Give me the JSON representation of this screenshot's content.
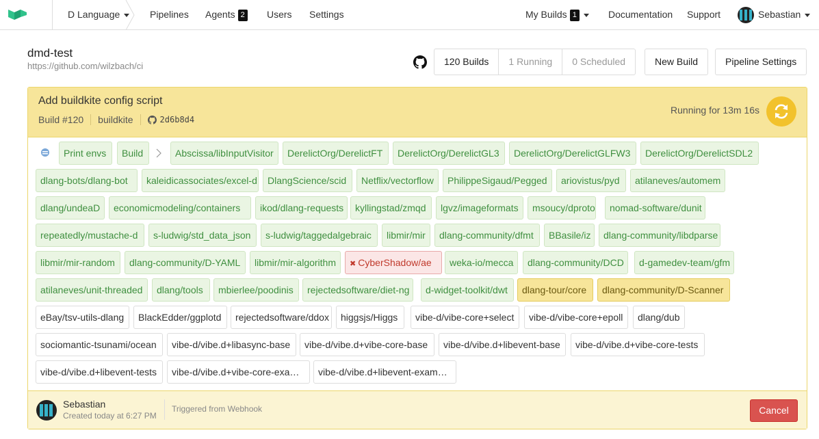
{
  "nav": {
    "org": "D Language",
    "links": [
      "Pipelines",
      "Agents",
      "Users",
      "Settings"
    ],
    "agents_count": "2",
    "my_builds": "My Builds",
    "my_builds_count": "1",
    "documentation": "Documentation",
    "support": "Support",
    "user": "Sebastian"
  },
  "pipeline": {
    "name": "dmd-test",
    "url": "https://github.com/wilzbach/ci",
    "builds": "120 Builds",
    "running": "1 Running",
    "scheduled": "0 Scheduled",
    "new_build": "New Build",
    "settings": "Pipeline Settings"
  },
  "build": {
    "message": "Add buildkite config script",
    "number": "Build #120",
    "branch": "buildkite",
    "commit": "2d6b8d4",
    "running_for": "Running for 13m 16s",
    "colors": {
      "head": "#f7e59a",
      "spinner": "#f2c22c",
      "passed": "#3f8f3f",
      "failed": "#c0392b"
    }
  },
  "jobs": [
    {
      "label": "",
      "state": "icon"
    },
    {
      "label": "Print envs",
      "state": "passed"
    },
    {
      "label": "Build",
      "state": "passed"
    },
    {
      "label": "Abscissa/libInputVisitor",
      "state": "passed"
    },
    {
      "label": "DerelictOrg/DerelictFT",
      "state": "passed"
    },
    {
      "label": "DerelictOrg/DerelictGL3",
      "state": "passed"
    },
    {
      "label": "DerelictOrg/DerelictGLFW3",
      "state": "passed"
    },
    {
      "label": "DerelictOrg/DerelictSDL2",
      "state": "passed"
    },
    {
      "label": "dlang-bots/dlang-bot",
      "state": "passed"
    },
    {
      "label": "kaleidicassociates/excel-d",
      "state": "passed"
    },
    {
      "label": "DlangScience/scid",
      "state": "passed"
    },
    {
      "label": "Netflix/vectorflow",
      "state": "passed"
    },
    {
      "label": "PhilippeSigaud/Pegged",
      "state": "passed"
    },
    {
      "label": "ariovistus/pyd",
      "state": "passed"
    },
    {
      "label": "atilaneves/automem",
      "state": "passed"
    },
    {
      "label": "dlang/undeaD",
      "state": "passed"
    },
    {
      "label": "economicmodeling/containers",
      "state": "passed"
    },
    {
      "label": "ikod/dlang-requests",
      "state": "passed"
    },
    {
      "label": "kyllingstad/zmqd",
      "state": "passed"
    },
    {
      "label": "lgvz/imageformats",
      "state": "passed"
    },
    {
      "label": "msoucy/dproto",
      "state": "passed"
    },
    {
      "label": "nomad-software/dunit",
      "state": "passed"
    },
    {
      "label": "repeatedly/mustache-d",
      "state": "passed"
    },
    {
      "label": "s-ludwig/std_data_json",
      "state": "passed"
    },
    {
      "label": "s-ludwig/taggedalgebraic",
      "state": "passed"
    },
    {
      "label": "libmir/mir",
      "state": "passed"
    },
    {
      "label": "dlang-community/dfmt",
      "state": "passed"
    },
    {
      "label": "BBasile/iz",
      "state": "passed"
    },
    {
      "label": "dlang-community/libdparse",
      "state": "passed"
    },
    {
      "label": "libmir/mir-random",
      "state": "passed"
    },
    {
      "label": "dlang-community/D-YAML",
      "state": "passed"
    },
    {
      "label": "libmir/mir-algorithm",
      "state": "passed"
    },
    {
      "label": "CyberShadow/ae",
      "state": "failed"
    },
    {
      "label": "weka-io/mecca",
      "state": "passed"
    },
    {
      "label": "dlang-community/DCD",
      "state": "passed"
    },
    {
      "label": "d-gamedev-team/gfm",
      "state": "passed"
    },
    {
      "label": "atilaneves/unit-threaded",
      "state": "passed"
    },
    {
      "label": "dlang/tools",
      "state": "passed"
    },
    {
      "label": "mbierlee/poodinis",
      "state": "passed"
    },
    {
      "label": "rejectedsoftware/diet-ng",
      "state": "passed"
    },
    {
      "label": "d-widget-toolkit/dwt",
      "state": "passed"
    },
    {
      "label": "dlang-tour/core",
      "state": "running"
    },
    {
      "label": "dlang-community/D-Scanner",
      "state": "running"
    },
    {
      "label": "eBay/tsv-utils-dlang",
      "state": "pending"
    },
    {
      "label": "BlackEdder/ggplotd",
      "state": "pending"
    },
    {
      "label": "rejectedsoftware/ddox",
      "state": "pending"
    },
    {
      "label": "higgsjs/Higgs",
      "state": "pending"
    },
    {
      "label": "vibe-d/vibe-core+select",
      "state": "pending"
    },
    {
      "label": "vibe-d/vibe-core+epoll",
      "state": "pending"
    },
    {
      "label": "dlang/dub",
      "state": "pending"
    },
    {
      "label": "sociomantic-tsunami/ocean",
      "state": "pending"
    },
    {
      "label": "vibe-d/vibe.d+libasync-base",
      "state": "pending"
    },
    {
      "label": "vibe-d/vibe.d+vibe-core-base",
      "state": "pending"
    },
    {
      "label": "vibe-d/vibe.d+libevent-base",
      "state": "pending"
    },
    {
      "label": "vibe-d/vibe.d+vibe-core-tests",
      "state": "pending"
    },
    {
      "label": "vibe-d/vibe.d+libevent-tests",
      "state": "pending"
    },
    {
      "label": "vibe-d/vibe.d+vibe-core-exa…",
      "state": "pending"
    },
    {
      "label": "vibe-d/vibe.d+libevent-exam…",
      "state": "pending"
    }
  ],
  "footer": {
    "author": "Sebastian",
    "created": "Created today at 6:27 PM",
    "trigger": "Triggered from Webhook",
    "cancel": "Cancel"
  }
}
